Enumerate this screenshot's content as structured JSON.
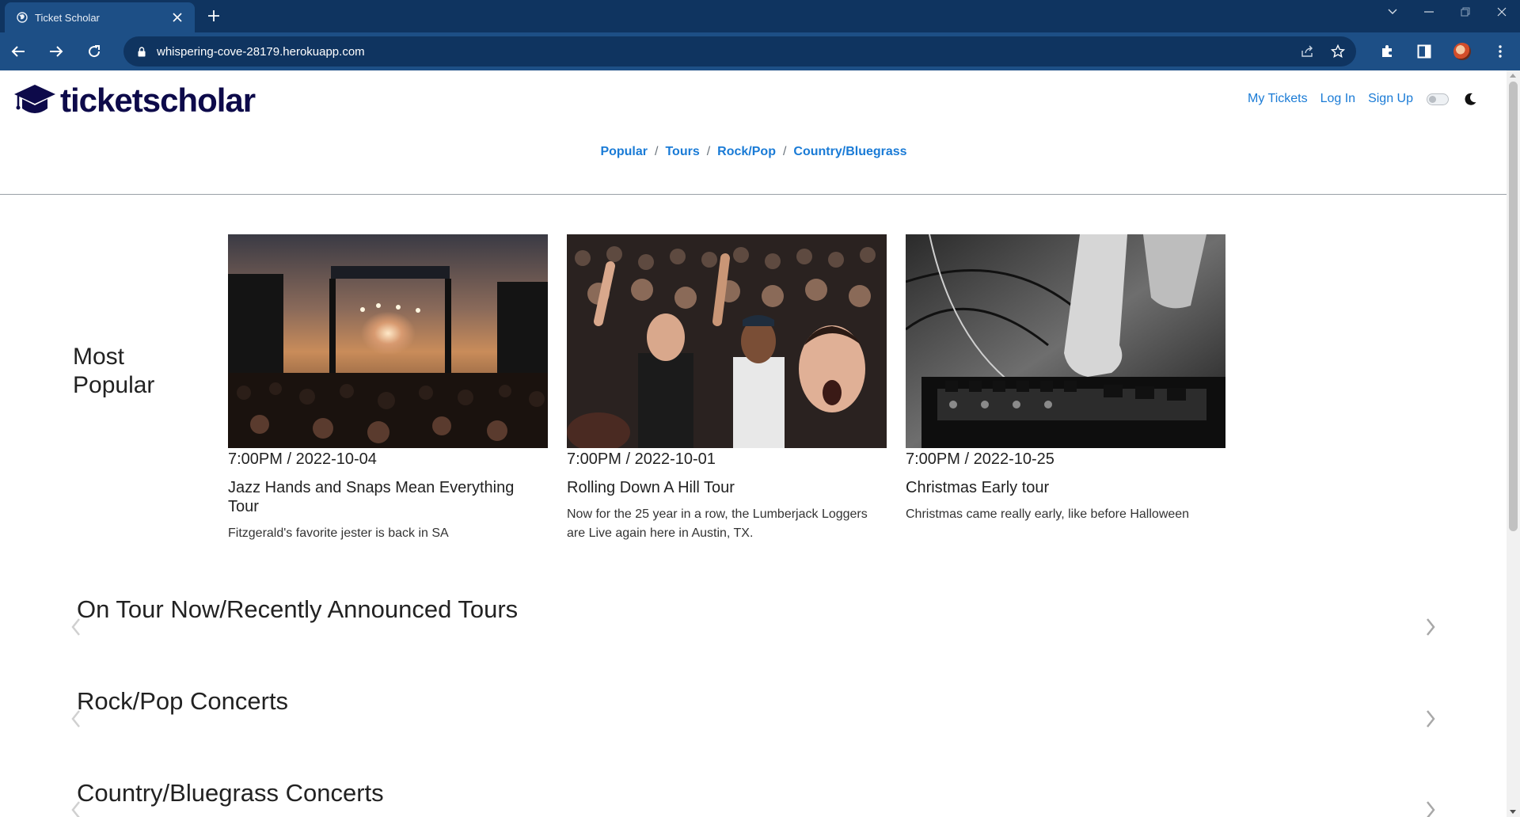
{
  "browser": {
    "tab_title": "Ticket Scholar",
    "url": "whispering-cove-28179.herokuapp.com"
  },
  "site": {
    "logo_text": "ticketscholar",
    "nav": {
      "my_tickets": "My Tickets",
      "log_in": "Log In",
      "sign_up": "Sign Up"
    },
    "categories": [
      "Popular",
      "Tours",
      "Rock/Pop",
      "Country/Bluegrass"
    ],
    "category_separator": "/"
  },
  "most_popular": {
    "title_line1": "Most",
    "title_line2": "Popular",
    "cards": [
      {
        "datetime": "7:00PM / 2022-10-04",
        "title": "Jazz Hands and Snaps Mean Everything Tour",
        "description": "Fitzgerald's favorite jester is back in SA"
      },
      {
        "datetime": "7:00PM / 2022-10-01",
        "title": "Rolling Down A Hill Tour",
        "description": "Now for the 25 year in a row, the Lumberjack Loggers are Live again here in Austin, TX."
      },
      {
        "datetime": "7:00PM / 2022-10-25",
        "title": "Christmas Early tour",
        "description": "Christmas came really early, like before Halloween"
      }
    ]
  },
  "sections": [
    "On Tour Now/Recently Announced Tours",
    "Rock/Pop Concerts",
    "Country/Bluegrass Concerts"
  ],
  "colors": {
    "chrome_dark": "#0f3460",
    "chrome_light": "#1d4f86",
    "link": "#1a7bd6",
    "logo": "#0d0a4a"
  }
}
